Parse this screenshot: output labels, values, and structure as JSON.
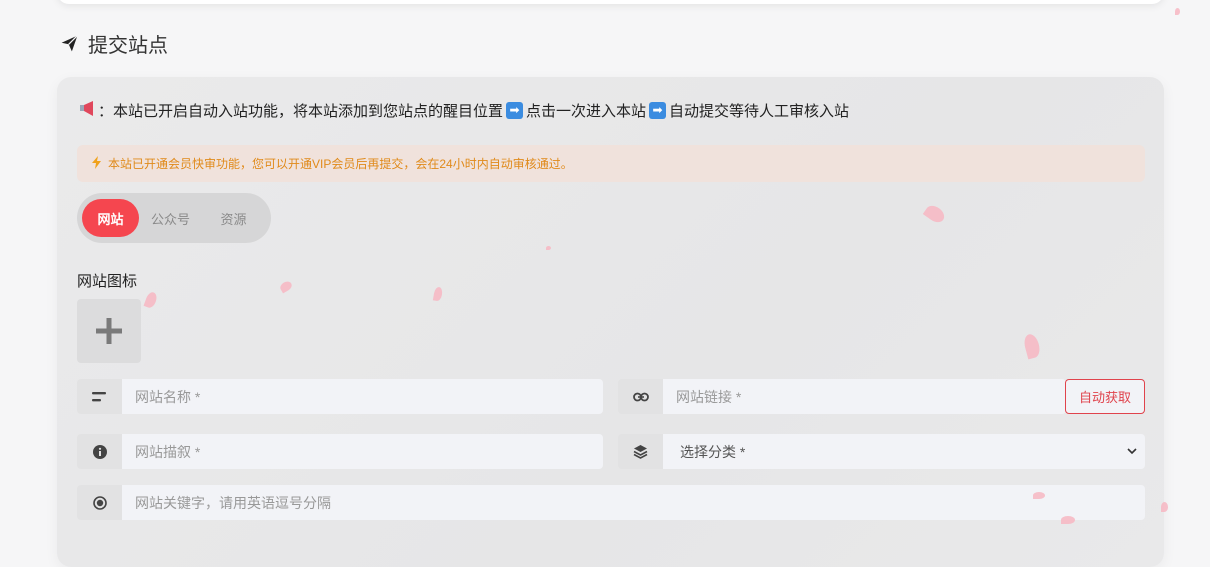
{
  "section": {
    "title": "提交站点",
    "icon": "paper-plane-icon"
  },
  "notice": {
    "icon": "megaphone-icon",
    "part1": "：本站已开启自动入站功能，将本站添加到您站点的醒目位置",
    "arrow1": "➡",
    "part2": "点击一次进入本站",
    "arrow2": "➡",
    "part3": "自动提交等待人工审核入站"
  },
  "vip_alert": {
    "icon": "bolt-icon",
    "text": "本站已开通会员快审功能，您可以开通VIP会员后再提交，会在24小时内自动审核通过。"
  },
  "tabs": [
    {
      "label": "网站",
      "active": true
    },
    {
      "label": "公众号",
      "active": false
    },
    {
      "label": "资源",
      "active": false
    }
  ],
  "form": {
    "icon_label": "网站图标",
    "name": {
      "placeholder": "网站名称 *",
      "icon": "text-lines-icon"
    },
    "url": {
      "placeholder": "网站链接 *",
      "icon": "link-icon"
    },
    "auto_fetch": "自动获取",
    "desc": {
      "placeholder": "网站描叙 *",
      "icon": "info-circle-icon"
    },
    "category": {
      "selected": "选择分类 *",
      "icon": "layers-icon"
    },
    "keywords": {
      "placeholder": "网站关键字，请用英语逗号分隔",
      "icon": "radio-dot-icon"
    }
  },
  "colors": {
    "accent": "#f5464f",
    "alert_text": "#e08a1a",
    "alert_bg": "#f0e2dc"
  }
}
